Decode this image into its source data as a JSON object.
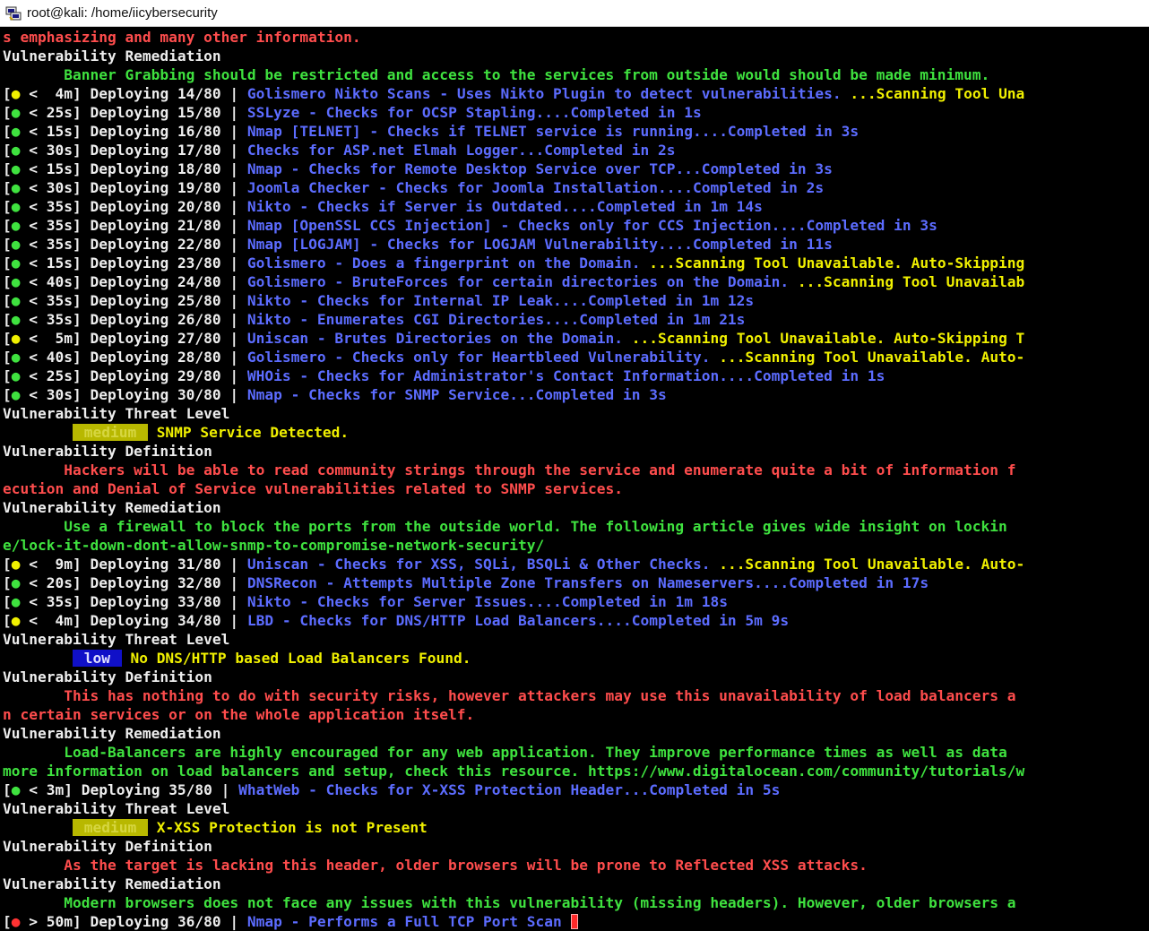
{
  "window": {
    "title": "root@kali: /home/iicybersecurity",
    "icon": "putty-terminal-icon"
  },
  "colors": {
    "background": "#000000",
    "red_text": "#ff4d4d",
    "green_text": "#3fe23f",
    "blue_text": "#5c6cff",
    "yellow_text": "#f0f000",
    "medium_badge": "#b8b800",
    "low_badge": "#1010c8"
  },
  "lines": [
    {
      "type": "text",
      "color": "red",
      "text": "s emphasizing and many other information."
    },
    {
      "type": "text",
      "color": "white",
      "text": "Vulnerability Remediation"
    },
    {
      "type": "text",
      "color": "green",
      "text": "       Banner Grabbing should be restricted and access to the services from outside would should be made minimum."
    },
    {
      "type": "deploy",
      "dot": "yellow",
      "time": "<  4m]",
      "count": "Deploying 14/80",
      "desc": "Golismero Nikto Scans - Uses Nikto Plugin to detect vulnerabilities.",
      "status": " ...Scanning Tool Una",
      "status_color": "yellow"
    },
    {
      "type": "deploy",
      "dot": "green",
      "time": "< 25s]",
      "count": "Deploying 15/80",
      "desc": "SSLyze - Checks for OCSP Stapling....Completed in 1s",
      "status": "",
      "status_color": "blue"
    },
    {
      "type": "deploy",
      "dot": "green",
      "time": "< 15s]",
      "count": "Deploying 16/80",
      "desc": "Nmap [TELNET] - Checks if TELNET service is running....Completed in 3s",
      "status": "",
      "status_color": "blue"
    },
    {
      "type": "deploy",
      "dot": "green",
      "time": "< 30s]",
      "count": "Deploying 17/80",
      "desc": "Checks for ASP.net Elmah Logger...Completed in 2s",
      "status": "",
      "status_color": "blue"
    },
    {
      "type": "deploy",
      "dot": "green",
      "time": "< 15s]",
      "count": "Deploying 18/80",
      "desc": "Nmap - Checks for Remote Desktop Service over TCP...Completed in 3s",
      "status": "",
      "status_color": "blue"
    },
    {
      "type": "deploy",
      "dot": "green",
      "time": "< 30s]",
      "count": "Deploying 19/80",
      "desc": "Joomla Checker - Checks for Joomla Installation....Completed in 2s",
      "status": "",
      "status_color": "blue"
    },
    {
      "type": "deploy",
      "dot": "green",
      "time": "< 35s]",
      "count": "Deploying 20/80",
      "desc": "Nikto - Checks if Server is Outdated....Completed in 1m 14s",
      "status": "",
      "status_color": "blue"
    },
    {
      "type": "deploy",
      "dot": "green",
      "time": "< 35s]",
      "count": "Deploying 21/80",
      "desc": "Nmap [OpenSSL CCS Injection] - Checks only for CCS Injection....Completed in 3s",
      "status": "",
      "status_color": "blue"
    },
    {
      "type": "deploy",
      "dot": "green",
      "time": "< 35s]",
      "count": "Deploying 22/80",
      "desc": "Nmap [LOGJAM] - Checks for LOGJAM Vulnerability....Completed in 11s",
      "status": "",
      "status_color": "blue"
    },
    {
      "type": "deploy",
      "dot": "green",
      "time": "< 15s]",
      "count": "Deploying 23/80",
      "desc": "Golismero - Does a fingerprint on the Domain.",
      "status": " ...Scanning Tool Unavailable. Auto-Skipping",
      "status_color": "yellow"
    },
    {
      "type": "deploy",
      "dot": "green",
      "time": "< 40s]",
      "count": "Deploying 24/80",
      "desc": "Golismero - BruteForces for certain directories on the Domain.",
      "status": " ...Scanning Tool Unavailab",
      "status_color": "yellow"
    },
    {
      "type": "deploy",
      "dot": "green",
      "time": "< 35s]",
      "count": "Deploying 25/80",
      "desc": "Nikto - Checks for Internal IP Leak....Completed in 1m 12s",
      "status": "",
      "status_color": "blue"
    },
    {
      "type": "deploy",
      "dot": "green",
      "time": "< 35s]",
      "count": "Deploying 26/80",
      "desc": "Nikto - Enumerates CGI Directories....Completed in 1m 21s",
      "status": "",
      "status_color": "blue"
    },
    {
      "type": "deploy",
      "dot": "yellow",
      "time": "<  5m]",
      "count": "Deploying 27/80",
      "desc": "Uniscan - Brutes Directories on the Domain.",
      "status": " ...Scanning Tool Unavailable. Auto-Skipping T",
      "status_color": "yellow"
    },
    {
      "type": "deploy",
      "dot": "green",
      "time": "< 40s]",
      "count": "Deploying 28/80",
      "desc": "Golismero - Checks only for Heartbleed Vulnerability.",
      "status": " ...Scanning Tool Unavailable. Auto-",
      "status_color": "yellow"
    },
    {
      "type": "deploy",
      "dot": "green",
      "time": "< 25s]",
      "count": "Deploying 29/80",
      "desc": "WHOis - Checks for Administrator's Contact Information....Completed in 1s",
      "status": "",
      "status_color": "blue"
    },
    {
      "type": "deploy",
      "dot": "green",
      "time": "< 30s]",
      "count": "Deploying 30/80",
      "desc": "Nmap - Checks for SNMP Service...Completed in 3s",
      "status": "",
      "status_color": "blue"
    },
    {
      "type": "text",
      "color": "white",
      "text": "Vulnerability Threat Level"
    },
    {
      "type": "threat",
      "level": "medium",
      "text": "SNMP Service Detected."
    },
    {
      "type": "text",
      "color": "white",
      "text": "Vulnerability Definition"
    },
    {
      "type": "text",
      "color": "red",
      "text": "       Hackers will be able to read community strings through the service and enumerate quite a bit of information f"
    },
    {
      "type": "text",
      "color": "red",
      "text": "ecution and Denial of Service vulnerabilities related to SNMP services."
    },
    {
      "type": "text",
      "color": "white",
      "text": "Vulnerability Remediation"
    },
    {
      "type": "text",
      "color": "green",
      "text": "       Use a firewall to block the ports from the outside world. The following article gives wide insight on lockin"
    },
    {
      "type": "text",
      "color": "green",
      "text": "e/lock-it-down-dont-allow-snmp-to-compromise-network-security/"
    },
    {
      "type": "deploy",
      "dot": "yellow",
      "time": "<  9m]",
      "count": "Deploying 31/80",
      "desc": "Uniscan - Checks for XSS, SQLi, BSQLi & Other Checks.",
      "status": " ...Scanning Tool Unavailable. Auto-",
      "status_color": "yellow"
    },
    {
      "type": "deploy",
      "dot": "green",
      "time": "< 20s]",
      "count": "Deploying 32/80",
      "desc": "DNSRecon - Attempts Multiple Zone Transfers on Nameservers....Completed in 17s",
      "status": "",
      "status_color": "blue"
    },
    {
      "type": "deploy",
      "dot": "green",
      "time": "< 35s]",
      "count": "Deploying 33/80",
      "desc": "Nikto - Checks for Server Issues....Completed in 1m 18s",
      "status": "",
      "status_color": "blue"
    },
    {
      "type": "deploy",
      "dot": "yellow",
      "time": "<  4m]",
      "count": "Deploying 34/80",
      "desc": "LBD - Checks for DNS/HTTP Load Balancers....Completed in 5m 9s",
      "status": "",
      "status_color": "blue"
    },
    {
      "type": "text",
      "color": "white",
      "text": "Vulnerability Threat Level"
    },
    {
      "type": "threat",
      "level": "low",
      "text": "No DNS/HTTP based Load Balancers Found."
    },
    {
      "type": "text",
      "color": "white",
      "text": "Vulnerability Definition"
    },
    {
      "type": "text",
      "color": "red",
      "text": "       This has nothing to do with security risks, however attackers may use this unavailability of load balancers a"
    },
    {
      "type": "text",
      "color": "red",
      "text": "n certain services or on the whole application itself."
    },
    {
      "type": "text",
      "color": "white",
      "text": "Vulnerability Remediation"
    },
    {
      "type": "text",
      "color": "green",
      "text": "       Load-Balancers are highly encouraged for any web application. They improve performance times as well as data"
    },
    {
      "type": "text",
      "color": "green",
      "text": "more information on load balancers and setup, check this resource. https://www.digitalocean.com/community/tutorials/w"
    },
    {
      "type": "deploy",
      "dot": "green",
      "time": "< 3m]",
      "count": "Deploying 35/80",
      "desc": "WhatWeb - Checks for X-XSS Protection Header...Completed in 5s",
      "status": "",
      "status_color": "blue"
    },
    {
      "type": "text",
      "color": "white",
      "text": "Vulnerability Threat Level"
    },
    {
      "type": "threat",
      "level": "medium",
      "text": "X-XSS Protection is not Present"
    },
    {
      "type": "text",
      "color": "white",
      "text": "Vulnerability Definition"
    },
    {
      "type": "text",
      "color": "red",
      "text": "       As the target is lacking this header, older browsers will be prone to Reflected XSS attacks."
    },
    {
      "type": "text",
      "color": "white",
      "text": "Vulnerability Remediation"
    },
    {
      "type": "text",
      "color": "green",
      "text": "       Modern browsers does not face any issues with this vulnerability (missing headers). However, older browsers a"
    },
    {
      "type": "deploy_active",
      "dot": "red",
      "time": "> 50m]",
      "count": "Deploying 36/80",
      "desc": "Nmap - Performs a Full TCP Port Scan ",
      "status": "",
      "status_color": "blue"
    }
  ]
}
